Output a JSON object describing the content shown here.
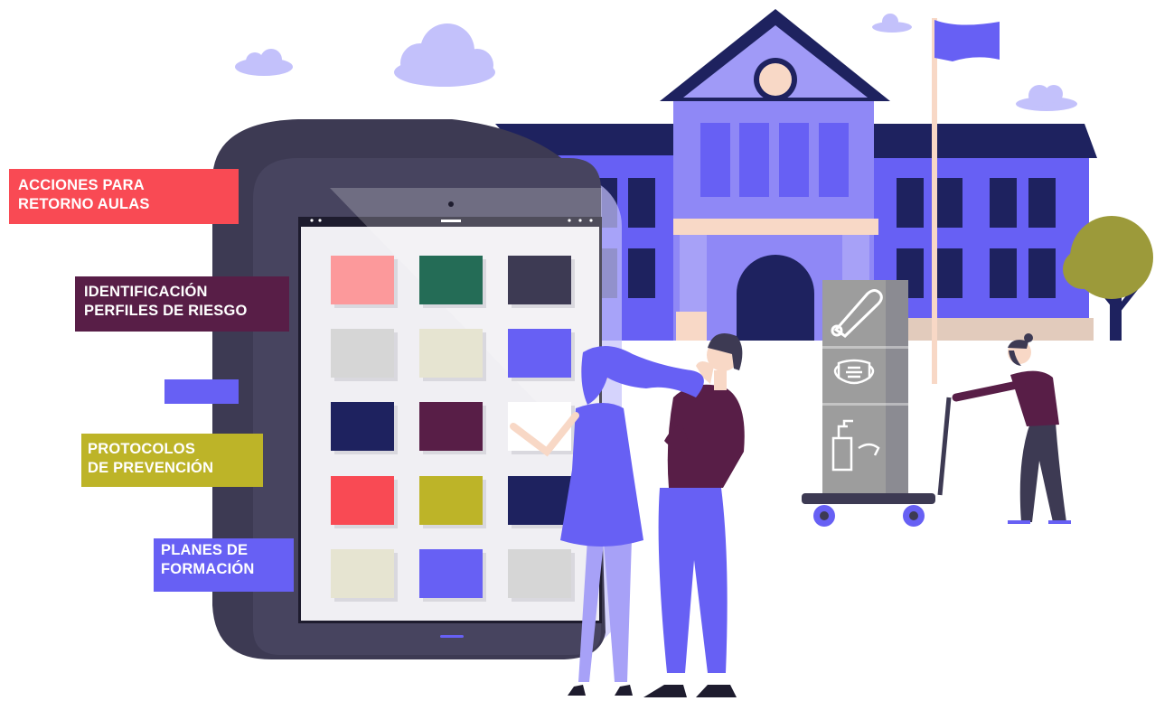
{
  "menu": [
    {
      "id": "acciones",
      "lines": [
        "ACCIONES PARA",
        "RETORNO AULAS"
      ],
      "color": "#f94a54"
    },
    {
      "id": "identificacion",
      "lines": [
        "IDENTIFICACIÓN",
        "PERFILES DE RIESGO"
      ],
      "color": "#581e47"
    },
    {
      "id": "blank",
      "lines": [],
      "color": "#6760f4"
    },
    {
      "id": "protocolos",
      "lines": [
        "PROTOCOLOS",
        "DE PREVENCIÓN"
      ],
      "color": "#bdb428"
    },
    {
      "id": "planes",
      "lines": [
        "PLANES DE",
        "FORMACIÓN"
      ],
      "color": "#6760f4"
    }
  ],
  "tablet_tiles": [
    "#fc999b",
    "#246c56",
    "#3d3a53",
    "#d6d6d6",
    "#e6e4d1",
    "#6760f4",
    "#1e225f",
    "#581e47",
    "#ffffff",
    "#f94a54",
    "#bdb428",
    "#1e225f",
    "#e6e4d1",
    "#6760f4",
    "#d6d6d6"
  ],
  "colors": {
    "building": "#6760f4",
    "roof": "#1e225f",
    "tablet_body": "#3d3a53",
    "station": "#9d9d9d",
    "tree": "#9c9a3a"
  },
  "icons": [
    "thermometer-icon",
    "face-mask-icon",
    "hand-sanitizer-icon"
  ]
}
